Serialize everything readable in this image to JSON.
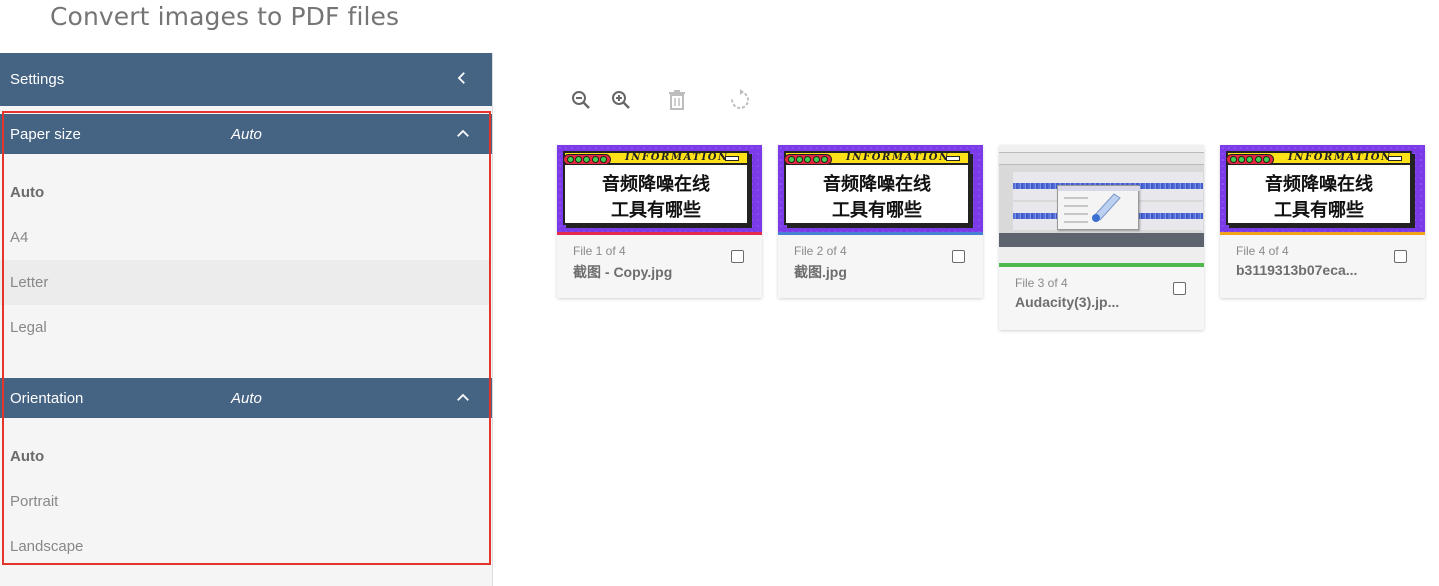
{
  "page": {
    "title": "Convert images to PDF files"
  },
  "settings": {
    "header_label": "Settings",
    "paper_size": {
      "label": "Paper size",
      "value": "Auto",
      "options": [
        "Auto",
        "A4",
        "Letter",
        "Legal"
      ],
      "selected": "Auto"
    },
    "orientation": {
      "label": "Orientation",
      "value": "Auto",
      "options": [
        "Auto",
        "Portrait",
        "Landscape"
      ],
      "selected": "Auto"
    }
  },
  "toolbar": {
    "icons": [
      "zoom-out-icon",
      "zoom-in-icon",
      "delete-icon",
      "rotate-icon"
    ]
  },
  "files": [
    {
      "index_label": "File 1 of 4",
      "name": "截图 - Copy.jpg",
      "checked": false,
      "thumb": "information-banner",
      "banner_title": "INFORMATION",
      "banner_line1": "音频降噪在线",
      "banner_line2": "工具有哪些",
      "bar_color": "#e32b4e"
    },
    {
      "index_label": "File 2 of 4",
      "name": "截图.jpg",
      "checked": false,
      "thumb": "information-banner",
      "banner_title": "INFORMATION",
      "banner_line1": "音频降噪在线",
      "banner_line2": "工具有哪些",
      "bar_color": "#4a7fd6"
    },
    {
      "index_label": "File 3 of 4",
      "name": "Audacity(3).jp...",
      "checked": false,
      "thumb": "audacity-screenshot",
      "bar_color": "#4fb84f"
    },
    {
      "index_label": "File 4 of 4",
      "name": "b3119313b07eca...",
      "checked": false,
      "thumb": "information-banner",
      "banner_title": "INFORMATION",
      "banner_line1": "音频降噪在线",
      "banner_line2": "工具有哪些",
      "bar_color": "#f0a21c"
    }
  ],
  "colors": {
    "header_bg": "#456383",
    "highlight_border": "#e3352c",
    "sidebar_bg": "#f5f5f5"
  }
}
